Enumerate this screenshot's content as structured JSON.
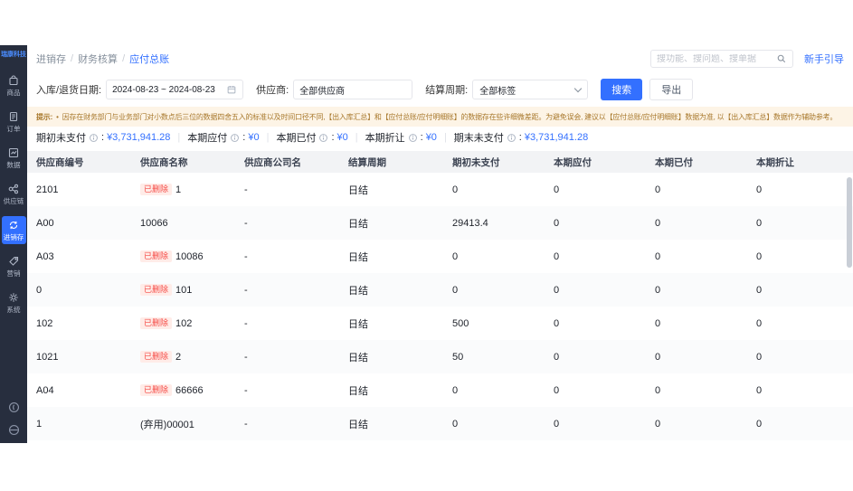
{
  "logo": "瑞康科技",
  "sidebar": {
    "items": [
      {
        "label": "商品"
      },
      {
        "label": "订单"
      },
      {
        "label": "数据"
      },
      {
        "label": "供应链"
      },
      {
        "label": "进销存"
      },
      {
        "label": "营销"
      },
      {
        "label": "系统"
      }
    ]
  },
  "breadcrumb": {
    "separator": "/",
    "items": [
      "进销存",
      "财务核算",
      "应付总账"
    ]
  },
  "topbar": {
    "search_placeholder": "搜功能、搜问题、搜单据",
    "guide": "新手引导"
  },
  "filters": {
    "date_label": "入库/退货日期:",
    "date_value": "2024-08-23 ~ 2024-08-23",
    "supplier_label": "供应商:",
    "supplier_value": "全部供应商",
    "period_label": "结算周期:",
    "period_value": "全部标签",
    "search_btn": "搜索",
    "export_btn": "导出"
  },
  "notice": {
    "prefix": "提示:",
    "bullet": "•",
    "text": "因存在财务部门与业务部门对小数点后三位的数据四舍五入的标准以及时间口径不同,【出入库汇总】和【应付总账/应付明细账】的数据存在些许细微差距。为避免误会, 建议以【应付总账/应付明细账】数据为准, 以【出入库汇总】数据作为辅助参考。"
  },
  "summary": {
    "separator": "|",
    "colon": ":",
    "items": [
      {
        "label": "期初未支付",
        "value": "¥3,731,941.28"
      },
      {
        "label": "本期应付",
        "value": "¥0"
      },
      {
        "label": "本期已付",
        "value": "¥0"
      },
      {
        "label": "本期折让",
        "value": "¥0"
      },
      {
        "label": "期末未支付",
        "value": "¥3,731,941.28"
      }
    ]
  },
  "table": {
    "headers": [
      "供应商编号",
      "供应商名称",
      "供应商公司名",
      "结算周期",
      "期初未支付",
      "本期应付",
      "本期已付",
      "本期折让"
    ],
    "deleted_badge": "已删除",
    "rows": [
      {
        "code": "2101",
        "name": "1",
        "company": "-",
        "period": "日结",
        "opening": "0",
        "payable": "0",
        "paid": "0",
        "discount": "0"
      },
      {
        "code": "A00",
        "name": "10066",
        "company": "-",
        "period": "日结",
        "opening": "29413.4",
        "payable": "0",
        "paid": "0",
        "discount": "0"
      },
      {
        "code": "A03",
        "name": "10086",
        "company": "-",
        "period": "日结",
        "opening": "0",
        "payable": "0",
        "paid": "0",
        "discount": "0"
      },
      {
        "code": "0",
        "name": "101",
        "company": "-",
        "period": "日结",
        "opening": "0",
        "payable": "0",
        "paid": "0",
        "discount": "0"
      },
      {
        "code": "102",
        "name": "102",
        "company": "-",
        "period": "日结",
        "opening": "500",
        "payable": "0",
        "paid": "0",
        "discount": "0"
      },
      {
        "code": "1021",
        "name": "2",
        "company": "-",
        "period": "日结",
        "opening": "50",
        "payable": "0",
        "paid": "0",
        "discount": "0"
      },
      {
        "code": "A04",
        "name": "66666",
        "company": "-",
        "period": "日结",
        "opening": "0",
        "payable": "0",
        "paid": "0",
        "discount": "0"
      },
      {
        "code": "1",
        "name": "(弃用)00001",
        "company": "-",
        "period": "日结",
        "opening": "0",
        "payable": "0",
        "paid": "0",
        "discount": "0"
      }
    ]
  }
}
